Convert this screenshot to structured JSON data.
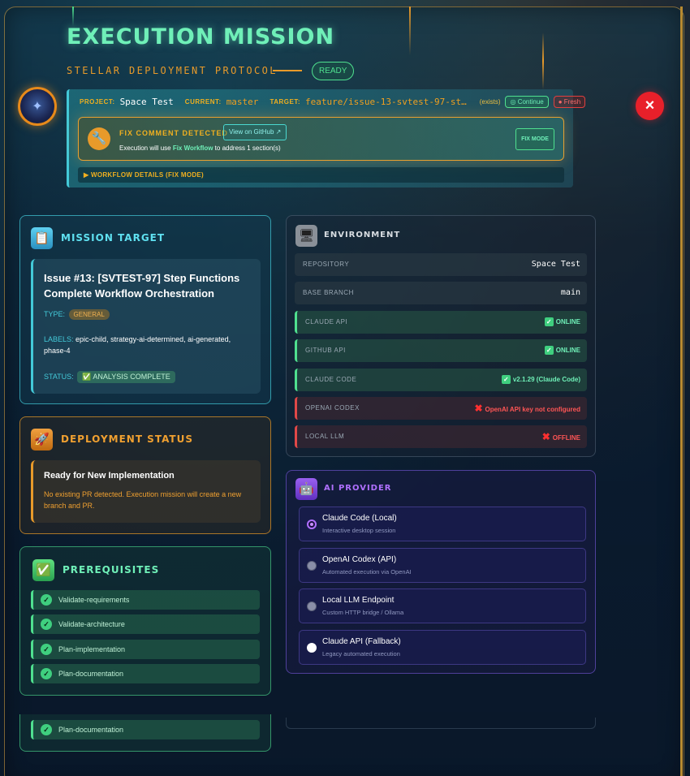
{
  "header": {
    "title": "EXECUTION MISSION",
    "subtitle": "STELLAR DEPLOYMENT PROTOCOL",
    "status_badge": "READY",
    "close_icon": "×"
  },
  "context": {
    "project_label": "PROJECT:",
    "project_value": "Space Test",
    "current_label": "CURRENT:",
    "current_value": "master",
    "target_label": "TARGET:",
    "target_value": "feature/issue-13-svtest-97-st…",
    "exists_text": "(exists)",
    "continue_label": "◎ Continue",
    "fresh_label": "● Fresh"
  },
  "fix_comment": {
    "title": "FIX COMMENT DETECTED",
    "view_button": "View on GitHub ↗",
    "desc_prefix": "Execution will use ",
    "desc_highlight": "Fix Workflow",
    "desc_suffix": " to address 1 section(s)",
    "mode_button": "FIX MODE",
    "icon": "🔧"
  },
  "workflow_details": "▶  WORKFLOW DETAILS (FIX MODE)",
  "mission_target": {
    "title": "MISSION TARGET",
    "icon": "📋",
    "issue_title": "Issue #13: [SVTEST-97] Step Functions Complete Workflow Orchestration",
    "type_label": "TYPE:",
    "type_value": "GENERAL",
    "labels_label": "LABELS:",
    "labels_value": "epic-child, strategy-ai-determined, ai-generated, phase-4",
    "status_label": "STATUS:",
    "status_value": "✅ ANALYSIS COMPLETE"
  },
  "deployment_status": {
    "title": "DEPLOYMENT STATUS",
    "icon": "🚀",
    "card_title": "Ready for New Implementation",
    "card_desc": "No existing PR detected. Execution mission will create a new branch and PR."
  },
  "prerequisites": {
    "title": "PREREQUISITES",
    "icon": "✅",
    "items": [
      "Validate-requirements",
      "Validate-architecture",
      "Plan-implementation",
      "Plan-documentation"
    ],
    "overflow_item": "Plan-documentation"
  },
  "environment": {
    "title": "ENVIRONMENT",
    "icon": "🖥",
    "rows": [
      {
        "key": "REPOSITORY",
        "value": "Space Test"
      },
      {
        "key": "BASE BRANCH",
        "value": "main"
      },
      {
        "key": "CLAUDE API",
        "value": "ONLINE"
      },
      {
        "key": "GITHUB API",
        "value": "ONLINE"
      },
      {
        "key": "CLAUDE CODE",
        "value": "v2.1.29 (Claude Code)"
      },
      {
        "key": "OPENAI CODEX",
        "value": "OpenAI API key not configured"
      },
      {
        "key": "LOCAL LLM",
        "value": "OFFLINE"
      }
    ]
  },
  "ai_provider": {
    "title": "AI PROVIDER",
    "icon": "🤖",
    "options": [
      {
        "name": "Claude Code (Local)",
        "desc": "Interactive desktop session"
      },
      {
        "name": "OpenAI Codex (API)",
        "desc": "Automated execution via OpenAI"
      },
      {
        "name": "Local LLM Endpoint",
        "desc": "Custom HTTP bridge / Ollama"
      },
      {
        "name": "Claude API (Fallback)",
        "desc": "Legacy automated execution"
      }
    ]
  },
  "colors": {
    "title": "#6ff0b8",
    "accent_orange": "#e89a2a",
    "accent_cyan": "#43c9d8",
    "online": "#6ff0b8",
    "error": "#ff5555",
    "close": "#e8202a"
  }
}
